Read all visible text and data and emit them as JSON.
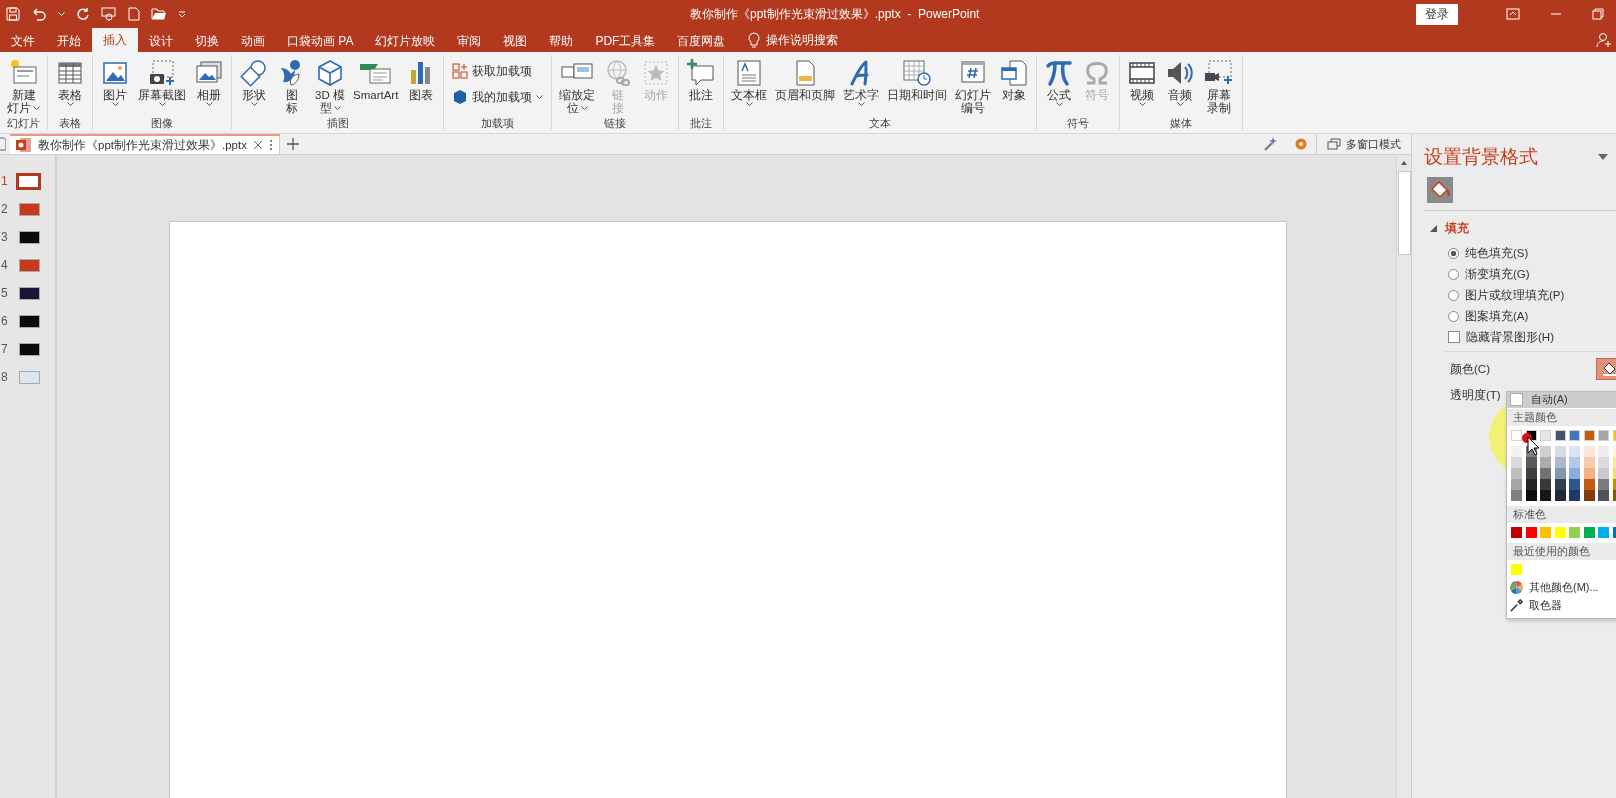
{
  "title_bar": {
    "title": "教你制作《ppt制作光束滑过效果》.pptx  -  PowerPoint",
    "sign_in": "登录"
  },
  "ribbon_tabs": [
    {
      "label": "文件",
      "selected": false
    },
    {
      "label": "开始",
      "selected": false
    },
    {
      "label": "插入",
      "selected": true
    },
    {
      "label": "设计",
      "selected": false
    },
    {
      "label": "切换",
      "selected": false
    },
    {
      "label": "动画",
      "selected": false
    },
    {
      "label": "口袋动画 PA",
      "selected": false
    },
    {
      "label": "幻灯片放映",
      "selected": false
    },
    {
      "label": "审阅",
      "selected": false
    },
    {
      "label": "视图",
      "selected": false
    },
    {
      "label": "帮助",
      "selected": false
    },
    {
      "label": "PDF工具集",
      "selected": false
    },
    {
      "label": "百度网盘",
      "selected": false
    }
  ],
  "tell_me": "操作说明搜索",
  "ribbon_groups": [
    {
      "label": "幻灯片",
      "items": [
        {
          "kind": "large",
          "lines": [
            "新建",
            "灯片"
          ],
          "dropdown": true,
          "disabled": false
        }
      ]
    },
    {
      "label": "表格",
      "items": [
        {
          "kind": "large",
          "lines": [
            "表格"
          ],
          "dropdown": true,
          "disabled": false
        }
      ]
    },
    {
      "label": "图像",
      "items": [
        {
          "kind": "large",
          "lines": [
            "图片"
          ],
          "dropdown": true,
          "disabled": false
        },
        {
          "kind": "large",
          "lines": [
            "屏幕截图"
          ],
          "dropdown": true,
          "disabled": false
        },
        {
          "kind": "large",
          "lines": [
            "相册"
          ],
          "dropdown": true,
          "disabled": false
        }
      ]
    },
    {
      "label": "插图",
      "items": [
        {
          "kind": "large",
          "lines": [
            "形状"
          ],
          "dropdown": true,
          "disabled": false
        },
        {
          "kind": "large",
          "lines": [
            "图",
            "标"
          ],
          "dropdown": false,
          "disabled": false
        },
        {
          "kind": "large",
          "lines": [
            "3D 模",
            "型"
          ],
          "dropdown": true,
          "disabled": false
        },
        {
          "kind": "large",
          "lines": [
            "SmartArt"
          ],
          "dropdown": false,
          "disabled": false
        },
        {
          "kind": "large",
          "lines": [
            "图表"
          ],
          "dropdown": false,
          "disabled": false
        }
      ]
    },
    {
      "label": "加载项",
      "items": [
        {
          "kind": "small",
          "lines": [
            "获取加载项"
          ],
          "dropdown": false,
          "disabled": false
        },
        {
          "kind": "small",
          "lines": [
            "我的加载项"
          ],
          "dropdown": true,
          "disabled": false
        }
      ]
    },
    {
      "label": "链接",
      "items": [
        {
          "kind": "large",
          "lines": [
            "缩放定",
            "位"
          ],
          "dropdown": true,
          "disabled": false
        },
        {
          "kind": "large",
          "lines": [
            "链",
            "接"
          ],
          "dropdown": false,
          "disabled": true
        },
        {
          "kind": "large",
          "lines": [
            "动作"
          ],
          "dropdown": false,
          "disabled": true
        }
      ]
    },
    {
      "label": "批注",
      "items": [
        {
          "kind": "large",
          "lines": [
            "批注"
          ],
          "dropdown": false,
          "disabled": false
        }
      ]
    },
    {
      "label": "文本",
      "items": [
        {
          "kind": "large",
          "lines": [
            "文本框"
          ],
          "dropdown": true,
          "disabled": false
        },
        {
          "kind": "large",
          "lines": [
            "页眉和页脚"
          ],
          "dropdown": false,
          "disabled": false
        },
        {
          "kind": "large",
          "lines": [
            "艺术字"
          ],
          "dropdown": true,
          "disabled": false
        },
        {
          "kind": "large",
          "lines": [
            "日期和时间"
          ],
          "dropdown": false,
          "disabled": false
        },
        {
          "kind": "large",
          "lines": [
            "幻灯片",
            "编号"
          ],
          "dropdown": false,
          "disabled": false
        },
        {
          "kind": "large",
          "lines": [
            "对象"
          ],
          "dropdown": false,
          "disabled": false
        }
      ]
    },
    {
      "label": "符号",
      "items": [
        {
          "kind": "large",
          "lines": [
            "公式"
          ],
          "dropdown": true,
          "disabled": false
        },
        {
          "kind": "large",
          "lines": [
            "符号"
          ],
          "dropdown": false,
          "disabled": true
        }
      ]
    },
    {
      "label": "媒体",
      "items": [
        {
          "kind": "large",
          "lines": [
            "视频"
          ],
          "dropdown": true,
          "disabled": false
        },
        {
          "kind": "large",
          "lines": [
            "音频"
          ],
          "dropdown": true,
          "disabled": false
        },
        {
          "kind": "large",
          "lines": [
            "屏幕",
            "录制"
          ],
          "dropdown": false,
          "disabled": false
        }
      ]
    }
  ],
  "document_tabs": [
    {
      "title": "教你制作《ppt制作光束滑过效果》.pptx",
      "selected": true
    }
  ],
  "multi_window": "多窗口模式",
  "slides": [
    {
      "number": "1",
      "selected": true,
      "color": "#ffffff"
    },
    {
      "number": "2",
      "selected": false,
      "color": "#c8381c"
    },
    {
      "number": "3",
      "selected": false,
      "color": "#0a0a0a"
    },
    {
      "number": "4",
      "selected": false,
      "color": "#c8381c"
    },
    {
      "number": "5",
      "selected": false,
      "color": "#1c1436"
    },
    {
      "number": "6",
      "selected": false,
      "color": "#0a0a0a"
    },
    {
      "number": "7",
      "selected": false,
      "color": "#0a0a0a"
    },
    {
      "number": "8",
      "selected": false,
      "color": "#dce6ee"
    }
  ],
  "format_panel": {
    "title": "设置背景格式",
    "section": {
      "label": "填充",
      "expanded": true
    },
    "fill_options": [
      {
        "label": "纯色填充(S)",
        "selected": true
      },
      {
        "label": "渐变填充(G)",
        "selected": false
      },
      {
        "label": "图片或纹理填充(P)",
        "selected": false
      },
      {
        "label": "图案填充(A)",
        "selected": false
      }
    ],
    "hide_background": {
      "label": "隐藏背景图形(H)",
      "checked": false
    },
    "color_label": "颜色(C)",
    "transparency_label": "透明度(T)"
  },
  "color_menu": {
    "automatic": "自动(A)",
    "theme_heading": "主题颜色",
    "theme_columns": [
      {
        "shades": [
          {
            "color": "#ffffff"
          },
          {
            "color": "#f2f2f2"
          },
          {
            "color": "#d9d9d9"
          },
          {
            "color": "#bfbfbf"
          },
          {
            "color": "#a6a6a6"
          },
          {
            "color": "#808080"
          }
        ]
      },
      {
        "shades": [
          {
            "color": "#000000"
          },
          {
            "color": "#7f7f7f"
          },
          {
            "color": "#595959"
          },
          {
            "color": "#3f3f3f"
          },
          {
            "color": "#262626"
          },
          {
            "color": "#0d0d0d"
          }
        ]
      },
      {
        "shades": [
          {
            "color": "#e7e6e6"
          },
          {
            "color": "#d0cece"
          },
          {
            "color": "#aeabab"
          },
          {
            "color": "#757171"
          },
          {
            "color": "#3a3838"
          },
          {
            "color": "#171616"
          }
        ]
      },
      {
        "shades": [
          {
            "color": "#44546a"
          },
          {
            "color": "#d6dce5"
          },
          {
            "color": "#adb9ca"
          },
          {
            "color": "#8497b0"
          },
          {
            "color": "#333f50"
          },
          {
            "color": "#222a35"
          }
        ]
      },
      {
        "shades": [
          {
            "color": "#4472c4"
          },
          {
            "color": "#dae3f3"
          },
          {
            "color": "#b4c7e7"
          },
          {
            "color": "#8faadc"
          },
          {
            "color": "#2f5597"
          },
          {
            "color": "#203864"
          }
        ]
      },
      {
        "shades": [
          {
            "color": "#c55a11"
          },
          {
            "color": "#fbe5d6"
          },
          {
            "color": "#f8cbad"
          },
          {
            "color": "#f4b183"
          },
          {
            "color": "#c55a11"
          },
          {
            "color": "#843c0c"
          }
        ]
      },
      {
        "shades": [
          {
            "color": "#a5a5a5"
          },
          {
            "color": "#ededed"
          },
          {
            "color": "#dbdbdb"
          },
          {
            "color": "#c9c9c9"
          },
          {
            "color": "#7c7c7c"
          },
          {
            "color": "#525252"
          }
        ]
      },
      {
        "shades": [
          {
            "color": "#ffc000"
          },
          {
            "color": "#fff2cc"
          },
          {
            "color": "#ffe699"
          },
          {
            "color": "#ffd966"
          },
          {
            "color": "#bf9000"
          },
          {
            "color": "#7f6000"
          }
        ]
      }
    ],
    "standard_heading": "标准色",
    "standard_colors": [
      {
        "color": "#c00000"
      },
      {
        "color": "#ff0000"
      },
      {
        "color": "#ffc000"
      },
      {
        "color": "#ffff00"
      },
      {
        "color": "#92d050"
      },
      {
        "color": "#00b050"
      },
      {
        "color": "#00b0f0"
      },
      {
        "color": "#0070c0"
      }
    ],
    "recent_heading": "最近使用的颜色",
    "recent_colors": [
      {
        "color": "#ffff00"
      }
    ],
    "more_colors": "其他颜色(M)...",
    "eyedropper": "取色器"
  }
}
